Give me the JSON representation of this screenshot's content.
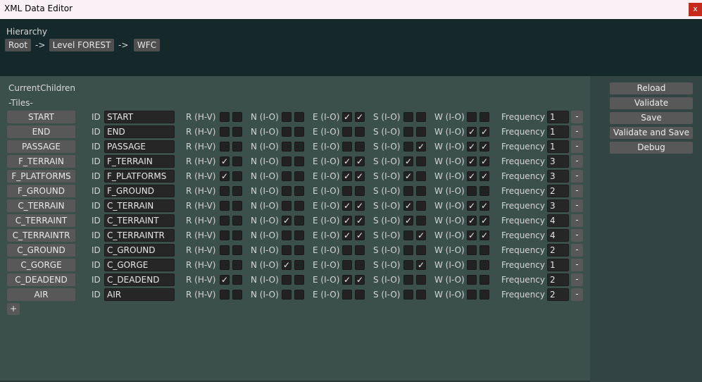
{
  "window": {
    "title": "XML Data Editor",
    "close_label": "x"
  },
  "hierarchy": {
    "label": "Hierarchy",
    "crumbs": [
      "Root",
      "Level FOREST",
      "WFC"
    ],
    "separator": "->"
  },
  "main": {
    "current_children_label": "CurrentChildren",
    "tiles_label": "-Tiles-",
    "id_label": "ID",
    "segment_labels": {
      "r": "R (H-V)",
      "n": "N (I-O)",
      "e": "E (I-O)",
      "s": "S (I-O)",
      "w": "W (I-O)"
    },
    "frequency_label": "Frequency",
    "minus_label": "-",
    "add_label": "+",
    "check_mark": "✓",
    "tiles": [
      {
        "name": "START",
        "id": "START",
        "r": [
          false,
          false
        ],
        "n": [
          false,
          false
        ],
        "e": [
          true,
          true
        ],
        "s": [
          false,
          false
        ],
        "w": [
          false,
          false
        ],
        "freq": "1"
      },
      {
        "name": "END",
        "id": "END",
        "r": [
          false,
          false
        ],
        "n": [
          false,
          false
        ],
        "e": [
          false,
          false
        ],
        "s": [
          false,
          false
        ],
        "w": [
          true,
          true
        ],
        "freq": "1"
      },
      {
        "name": "PASSAGE",
        "id": "PASSAGE",
        "r": [
          false,
          false
        ],
        "n": [
          false,
          false
        ],
        "e": [
          false,
          false
        ],
        "s": [
          false,
          true
        ],
        "w": [
          true,
          true
        ],
        "freq": "1"
      },
      {
        "name": "F_TERRAIN",
        "id": "F_TERRAIN",
        "r": [
          true,
          false
        ],
        "n": [
          false,
          false
        ],
        "e": [
          true,
          true
        ],
        "s": [
          true,
          false
        ],
        "w": [
          true,
          true
        ],
        "freq": "3"
      },
      {
        "name": "F_PLATFORMS",
        "id": "F_PLATFORMS",
        "r": [
          true,
          false
        ],
        "n": [
          false,
          false
        ],
        "e": [
          true,
          true
        ],
        "s": [
          true,
          false
        ],
        "w": [
          true,
          true
        ],
        "freq": "3"
      },
      {
        "name": "F_GROUND",
        "id": "F_GROUND",
        "r": [
          false,
          false
        ],
        "n": [
          false,
          false
        ],
        "e": [
          false,
          false
        ],
        "s": [
          false,
          false
        ],
        "w": [
          false,
          false
        ],
        "freq": "2"
      },
      {
        "name": "C_TERRAIN",
        "id": "C_TERRAIN",
        "r": [
          false,
          false
        ],
        "n": [
          false,
          false
        ],
        "e": [
          true,
          true
        ],
        "s": [
          true,
          false
        ],
        "w": [
          true,
          true
        ],
        "freq": "3"
      },
      {
        "name": "C_TERRAINT",
        "id": "C_TERRAINT",
        "r": [
          false,
          false
        ],
        "n": [
          true,
          false
        ],
        "e": [
          true,
          true
        ],
        "s": [
          true,
          false
        ],
        "w": [
          true,
          true
        ],
        "freq": "4"
      },
      {
        "name": "C_TERRAINTR",
        "id": "C_TERRAINTR",
        "r": [
          false,
          false
        ],
        "n": [
          false,
          false
        ],
        "e": [
          true,
          true
        ],
        "s": [
          false,
          true
        ],
        "w": [
          true,
          true
        ],
        "freq": "4"
      },
      {
        "name": "C_GROUND",
        "id": "C_GROUND",
        "r": [
          false,
          false
        ],
        "n": [
          false,
          false
        ],
        "e": [
          false,
          false
        ],
        "s": [
          false,
          false
        ],
        "w": [
          false,
          false
        ],
        "freq": "2"
      },
      {
        "name": "C_GORGE",
        "id": "C_GORGE",
        "r": [
          false,
          false
        ],
        "n": [
          true,
          false
        ],
        "e": [
          false,
          false
        ],
        "s": [
          false,
          true
        ],
        "w": [
          false,
          false
        ],
        "freq": "1"
      },
      {
        "name": "C_DEADEND",
        "id": "C_DEADEND",
        "r": [
          true,
          false
        ],
        "n": [
          false,
          false
        ],
        "e": [
          true,
          true
        ],
        "s": [
          false,
          false
        ],
        "w": [
          false,
          false
        ],
        "freq": "2"
      },
      {
        "name": "AIR",
        "id": "AIR",
        "r": [
          false,
          false
        ],
        "n": [
          false,
          false
        ],
        "e": [
          false,
          false
        ],
        "s": [
          false,
          false
        ],
        "w": [
          false,
          false
        ],
        "freq": "2"
      }
    ]
  },
  "side": {
    "reload": "Reload",
    "validate": "Validate",
    "save": "Save",
    "validate_and_save": "Validate and Save",
    "debug": "Debug"
  }
}
